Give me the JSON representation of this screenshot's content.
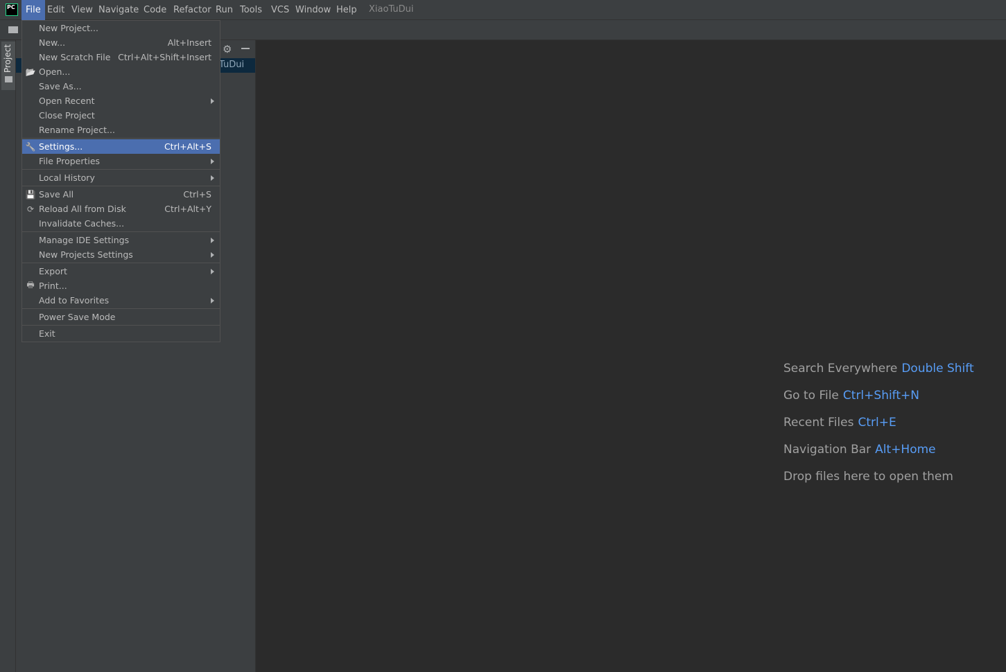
{
  "menubar": {
    "logo": "PC",
    "items": [
      "File",
      "Edit",
      "View",
      "Navigate",
      "Code",
      "Refactor",
      "Run",
      "Tools",
      "VCS",
      "Window",
      "Help"
    ],
    "active": "File",
    "project_name": "XiaoTuDui"
  },
  "tool_window": {
    "stripe_label": "Project",
    "selected_node": "TuDui"
  },
  "file_menu": [
    {
      "label": "New Project..."
    },
    {
      "label": "New...",
      "shortcut": "Alt+Insert"
    },
    {
      "label": "New Scratch File",
      "shortcut": "Ctrl+Alt+Shift+Insert"
    },
    {
      "label": "Open...",
      "icon": "folder-open-icon"
    },
    {
      "label": "Save As..."
    },
    {
      "label": "Open Recent",
      "submenu": true
    },
    {
      "label": "Close Project"
    },
    {
      "label": "Rename Project..."
    },
    {
      "separator": true
    },
    {
      "label": "Settings...",
      "shortcut": "Ctrl+Alt+S",
      "icon": "wrench-icon",
      "highlighted": true
    },
    {
      "label": "File Properties",
      "submenu": true
    },
    {
      "separator": true
    },
    {
      "label": "Local History",
      "submenu": true
    },
    {
      "separator": true
    },
    {
      "label": "Save All",
      "shortcut": "Ctrl+S",
      "icon": "save-icon"
    },
    {
      "label": "Reload All from Disk",
      "shortcut": "Ctrl+Alt+Y",
      "icon": "reload-icon"
    },
    {
      "label": "Invalidate Caches..."
    },
    {
      "separator": true
    },
    {
      "label": "Manage IDE Settings",
      "submenu": true
    },
    {
      "label": "New Projects Settings",
      "submenu": true
    },
    {
      "separator": true
    },
    {
      "label": "Export",
      "submenu": true
    },
    {
      "label": "Print...",
      "icon": "print-icon"
    },
    {
      "label": "Add to Favorites",
      "submenu": true
    },
    {
      "separator": true
    },
    {
      "label": "Power Save Mode"
    },
    {
      "separator": true
    },
    {
      "label": "Exit"
    }
  ],
  "editor_hints": [
    {
      "text": "Search Everywhere",
      "key": "Double Shift"
    },
    {
      "text": "Go to File",
      "key": "Ctrl+Shift+N"
    },
    {
      "text": "Recent Files",
      "key": "Ctrl+E"
    },
    {
      "text": "Navigation Bar",
      "key": "Alt+Home"
    },
    {
      "text": "Drop files here to open them",
      "key": ""
    }
  ],
  "colors": {
    "accent": "#4b6eaf",
    "shortcut_link": "#589df6",
    "background": "#2b2b2b",
    "panel": "#3c3f41"
  }
}
